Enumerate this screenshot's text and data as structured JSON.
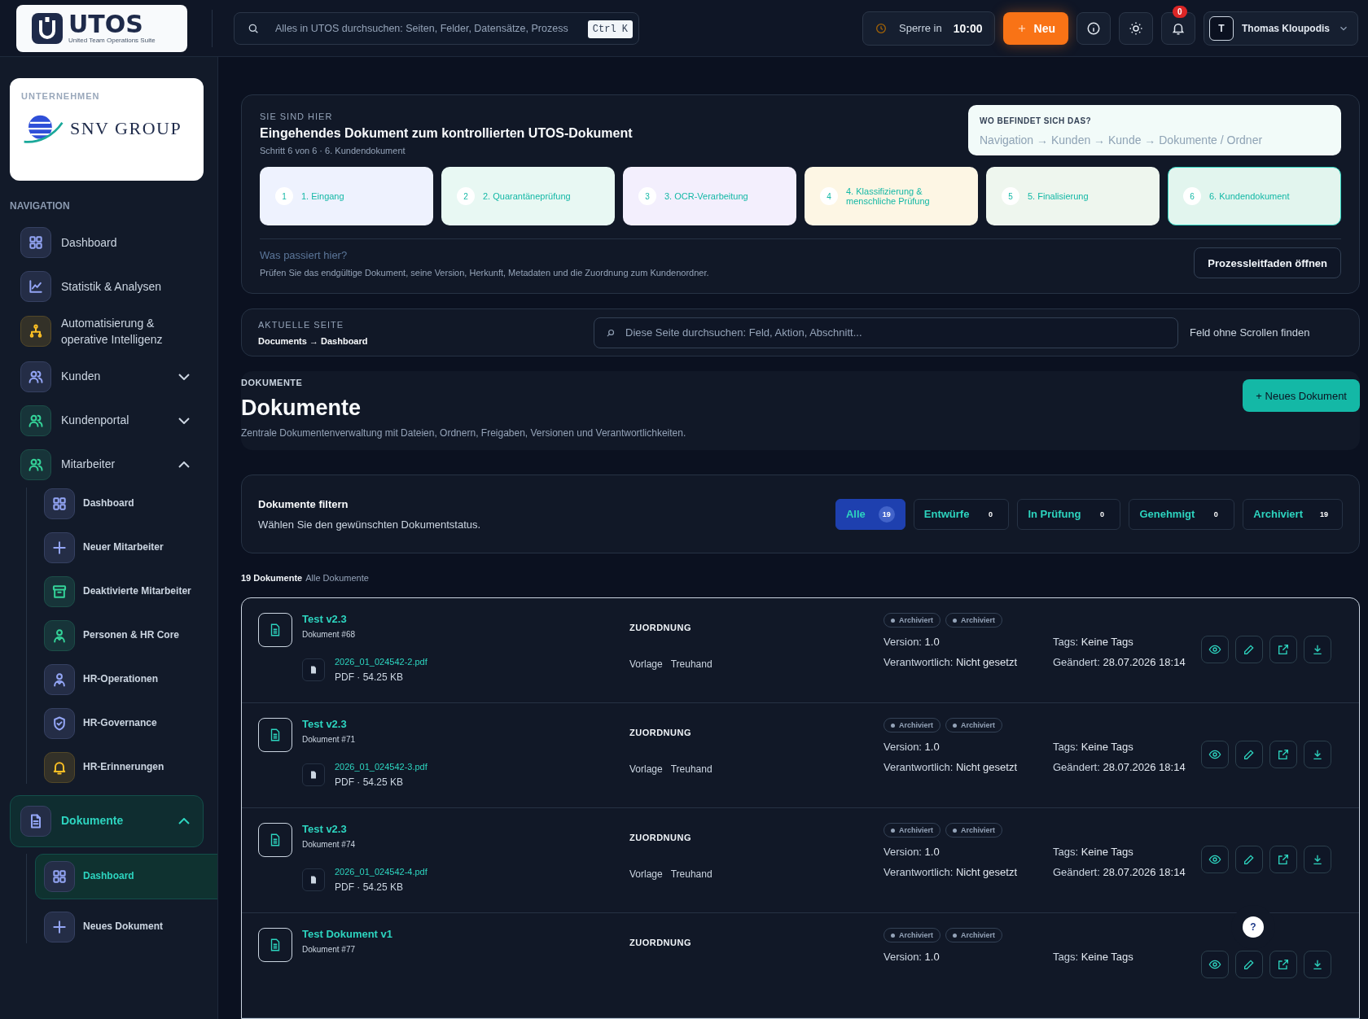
{
  "topbar": {
    "logo": {
      "title": "UTOS",
      "subtitle": "United Team Operations Suite"
    },
    "search": {
      "placeholder": "Alles in UTOS durchsuchen: Seiten, Felder, Datensätze, Prozess",
      "shortcut": "Ctrl K"
    },
    "lock": {
      "label": "Sperre in",
      "time": "10:00"
    },
    "new_button": "Neu",
    "notifications": "0",
    "user": {
      "initial": "T",
      "name": "Thomas Kloupodis"
    }
  },
  "sidebar": {
    "company": {
      "label": "UNTERNEHMEN",
      "name": "SNV GROUP"
    },
    "nav_title": "NAVIGATION",
    "items": [
      {
        "label": "Dashboard",
        "kind": "grid",
        "color": "#93a5f5",
        "selected": false
      },
      {
        "label": "Statistik & Analysen",
        "kind": "chart",
        "color": "#93a5f5",
        "selected": false
      },
      {
        "label": "Automatisierung & operative Intelligenz",
        "kind": "hierarchy",
        "color": "#fbbf24",
        "selected": false
      },
      {
        "label": "Kunden",
        "kind": "users",
        "color": "#93a5f5",
        "selected": false,
        "expanded": false
      },
      {
        "label": "Kundenportal",
        "kind": "users",
        "color": "#34d399",
        "selected": false,
        "expanded": false
      },
      {
        "label": "Mitarbeiter",
        "kind": "users",
        "color": "#34d399",
        "selected": false,
        "expanded": true,
        "children": [
          {
            "label": "Dashboard",
            "kind": "grid",
            "color": "#93a5f5",
            "selected": false
          },
          {
            "label": "Neuer Mitarbeiter",
            "kind": "plus",
            "color": "#93a5f5",
            "selected": false
          },
          {
            "label": "Deaktivierte Mitarbeiter",
            "kind": "archive",
            "color": "#34d399",
            "selected": false
          },
          {
            "label": "Personen & HR Core",
            "kind": "person",
            "color": "#34d399",
            "selected": false
          },
          {
            "label": "HR-Operationen",
            "kind": "person",
            "color": "#93a5f5",
            "selected": false
          },
          {
            "label": "HR-Governance",
            "kind": "shield",
            "color": "#93a5f5",
            "selected": false
          },
          {
            "label": "HR-Erinnerungen",
            "kind": "bell",
            "color": "#fbbf24",
            "selected": false
          }
        ]
      },
      {
        "label": "Dokumente",
        "kind": "file",
        "color": "#93a5f5",
        "selected": true,
        "expanded": true,
        "children": [
          {
            "label": "Dashboard",
            "kind": "grid",
            "color": "#93a5f5",
            "selected": true
          },
          {
            "label": "Neues Dokument",
            "kind": "plus",
            "color": "#93a5f5",
            "selected": false
          }
        ]
      }
    ]
  },
  "process": {
    "label": "SIE SIND HIER",
    "title": "Eingehendes Dokument zum kontrollierten UTOS-Dokument",
    "step_info": "Schritt 6 von 6 · 6. Kundendokument",
    "location": {
      "label": "WO BEFINDET SICH DAS?",
      "path": "Navigation → Kunden → Kunde → Dokumente / Ordner"
    },
    "steps": [
      {
        "number": "1",
        "label": "1. Eingang",
        "color": "#eef2fe",
        "selected": false
      },
      {
        "number": "2",
        "label": "2. Quarantäneprüfung",
        "color": "#e8f8f3",
        "selected": false
      },
      {
        "number": "3",
        "label": "3. OCR-Verarbeitung",
        "color": "#f3effd",
        "selected": false
      },
      {
        "number": "4",
        "label": "4. Klassifizierung & menschliche Prüfung",
        "color": "#fdf6e4",
        "selected": false
      },
      {
        "number": "5",
        "label": "5. Finalisierung",
        "color": "#eef6ee",
        "selected": false
      },
      {
        "number": "6",
        "label": "6. Kundendokument",
        "color": "#e2f5ee",
        "selected": true
      }
    ],
    "question": "Was passiert hier?",
    "description": "Prüfen Sie das endgültige Dokument, seine Version, Herkunft, Metadaten und die Zuordnung zum Kundenordner.",
    "button": "Prozessleitfaden öffnen"
  },
  "page_context": {
    "label": "AKTUELLE SEITE",
    "breadcrumb": "Documents → Dashboard",
    "search": {
      "placeholder": "Diese Seite durchsuchen: Feld, Aktion, Abschnitt..."
    },
    "hint": "Feld ohne Scrollen finden"
  },
  "header": {
    "eyebrow": "DOKUMENTE",
    "title": "Dokumente",
    "description": "Zentrale Dokumentenverwaltung mit Dateien, Ordnern, Freigaben, Versionen und Verantwortlichkeiten.",
    "button": "+ Neues Dokument"
  },
  "filter": {
    "title": "Dokumente filtern",
    "description": "Wählen Sie den gewünschten Dokumentstatus.",
    "options": [
      {
        "label": "Alle",
        "count": "19",
        "selected": true
      },
      {
        "label": "Entwürfe",
        "count": "0",
        "selected": false
      },
      {
        "label": "In Prüfung",
        "count": "0",
        "selected": false
      },
      {
        "label": "Genehmigt",
        "count": "0",
        "selected": false
      },
      {
        "label": "Archiviert",
        "count": "19",
        "selected": false
      }
    ]
  },
  "list": {
    "count": "19 Dokumente",
    "scope": "Alle Dokumente",
    "documents": [
      {
        "title": "Test v2.3",
        "number": "Dokument #68",
        "file": "2026_01_024542-2.pdf",
        "file_meta": "PDF · 54.25 KB",
        "section": "ZUORDNUNG",
        "assignments": [
          "Vorlage",
          "Treuhand"
        ],
        "badges": [
          "Archiviert",
          "Archiviert"
        ],
        "fields": [
          {
            "label": "Version:",
            "value": "1.0"
          },
          {
            "label": "Tags:",
            "value": "Keine Tags"
          },
          {
            "label": "Verantwortlich:",
            "value": "Nicht gesetzt"
          },
          {
            "label": "Geändert:",
            "value": "28.07.2026 18:14"
          }
        ]
      },
      {
        "title": "Test v2.3",
        "number": "Dokument #71",
        "file": "2026_01_024542-3.pdf",
        "file_meta": "PDF · 54.25 KB",
        "section": "ZUORDNUNG",
        "assignments": [
          "Vorlage",
          "Treuhand"
        ],
        "badges": [
          "Archiviert",
          "Archiviert"
        ],
        "fields": [
          {
            "label": "Version:",
            "value": "1.0"
          },
          {
            "label": "Tags:",
            "value": "Keine Tags"
          },
          {
            "label": "Verantwortlich:",
            "value": "Nicht gesetzt"
          },
          {
            "label": "Geändert:",
            "value": "28.07.2026 18:14"
          }
        ]
      },
      {
        "title": "Test v2.3",
        "number": "Dokument #74",
        "file": "2026_01_024542-4.pdf",
        "file_meta": "PDF · 54.25 KB",
        "section": "ZUORDNUNG",
        "assignments": [
          "Vorlage",
          "Treuhand"
        ],
        "badges": [
          "Archiviert",
          "Archiviert"
        ],
        "fields": [
          {
            "label": "Version:",
            "value": "1.0"
          },
          {
            "label": "Tags:",
            "value": "Keine Tags"
          },
          {
            "label": "Verantwortlich:",
            "value": "Nicht gesetzt"
          },
          {
            "label": "Geändert:",
            "value": "28.07.2026 18:14"
          }
        ]
      },
      {
        "title": "Test Dokument v1",
        "number": "Dokument #77",
        "section": "ZUORDNUNG",
        "badges": [
          "Archiviert",
          "Archiviert"
        ],
        "fields": [
          {
            "label": "Version:",
            "value": "1.0"
          },
          {
            "label": "Tags:",
            "value": "Keine Tags"
          }
        ]
      }
    ]
  },
  "help_button": "?"
}
